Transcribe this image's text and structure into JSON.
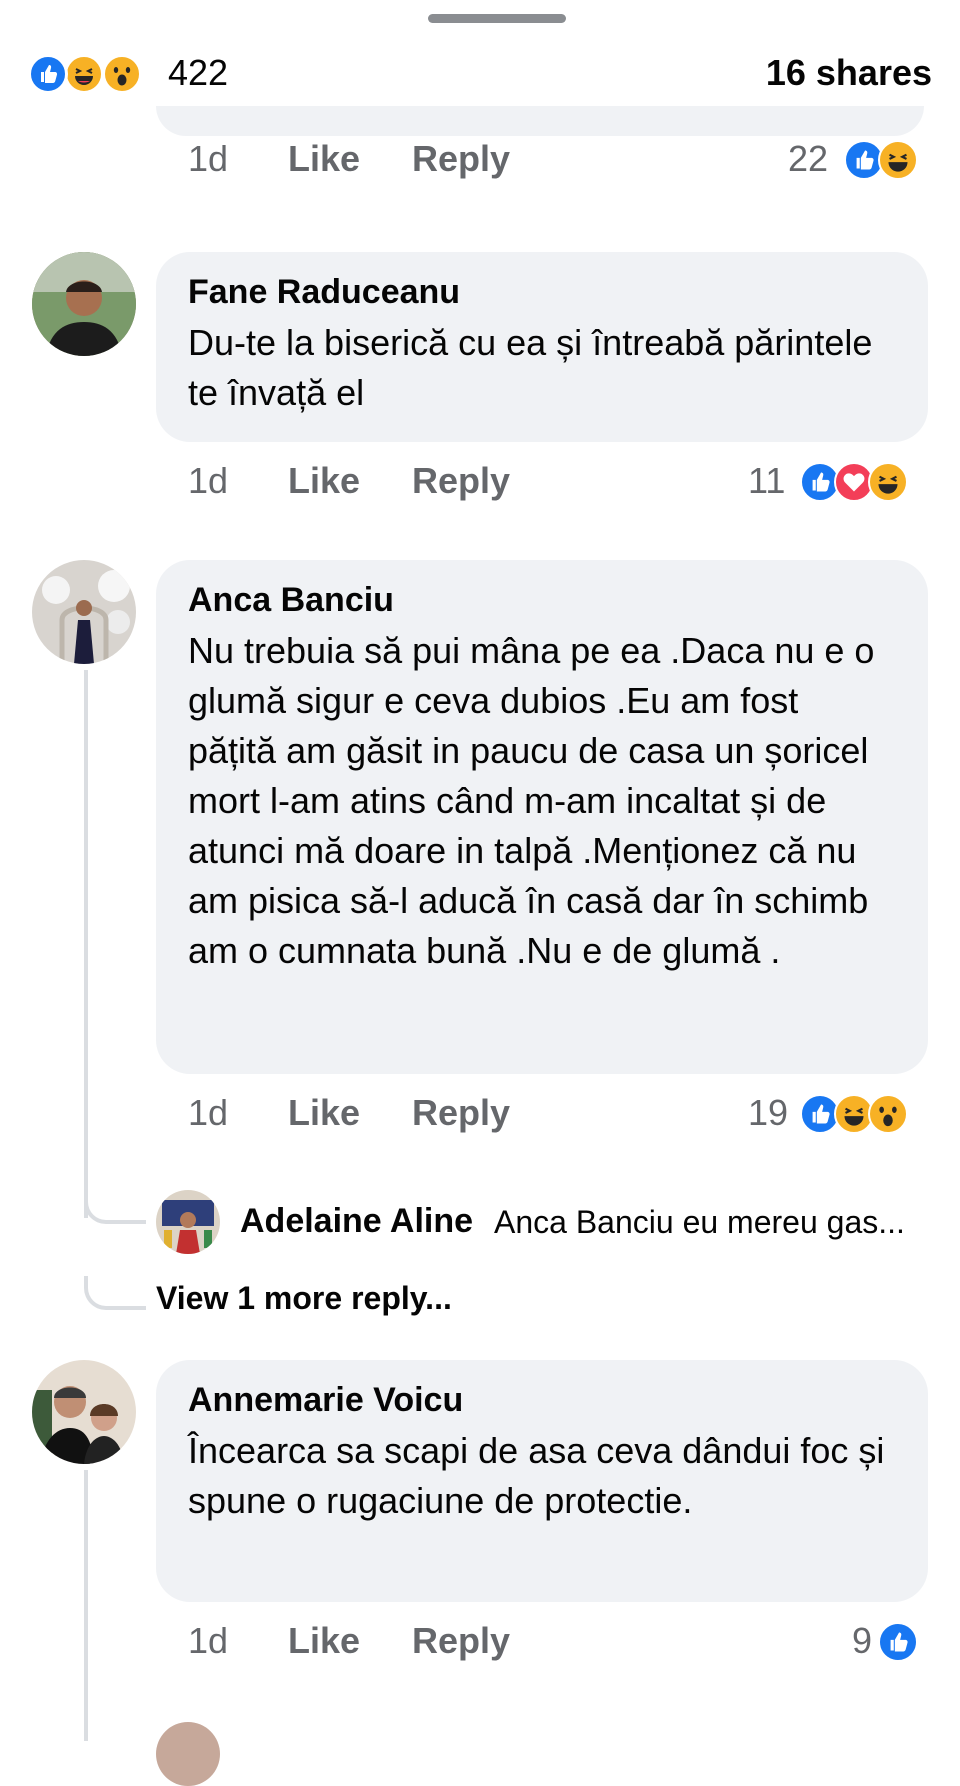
{
  "header": {
    "reaction_count": "422",
    "shares": "16 shares",
    "reactions": [
      "like-icon",
      "haha-icon",
      "wow-icon"
    ]
  },
  "colors": {
    "like_blue": "#1877f2",
    "love_red": "#f33e58",
    "haha_yellow": "#f7b125",
    "bubble_bg": "#f0f2f5",
    "meta_gray": "#65676b"
  },
  "comments": [
    {
      "time": "1d",
      "like": "Like",
      "reply": "Reply",
      "reactions_count": "22",
      "reactions": [
        "like-icon",
        "haha-icon"
      ]
    },
    {
      "author": "Fane Raduceanu",
      "text": "Du-te la biserică cu ea și întreabă părintele te învață el",
      "time": "1d",
      "like": "Like",
      "reply": "Reply",
      "reactions_count": "11",
      "reactions": [
        "like-icon",
        "love-icon",
        "haha-icon"
      ]
    },
    {
      "author": "Anca Banciu",
      "text": "Nu trebuia să pui mâna pe ea .Daca nu e o glumă sigur e ceva dubios .Eu am fost pățită am găsit in paucu de casa un șoricel mort  l-am atins când m-am incaltat și de atunci mă doare in talpă .Menționez că nu am pisica să-l aducă în casă dar în schimb am o cumnata bună .Nu e de glumă .",
      "time": "1d",
      "like": "Like",
      "reply": "Reply",
      "reactions_count": "19",
      "reactions": [
        "like-icon",
        "haha-icon",
        "wow-icon"
      ],
      "reply_preview": {
        "author": "Adelaine Aline",
        "text": "Anca Banciu eu mereu gas..."
      },
      "view_more": "View 1 more reply..."
    },
    {
      "author": "Annemarie Voicu",
      "text": "Încearca sa scapi de asa ceva dândui foc și spune o rugaciune de protectie.",
      "time": "1d",
      "like": "Like",
      "reply": "Reply",
      "reactions_count": "9",
      "reactions": [
        "like-icon"
      ]
    }
  ]
}
